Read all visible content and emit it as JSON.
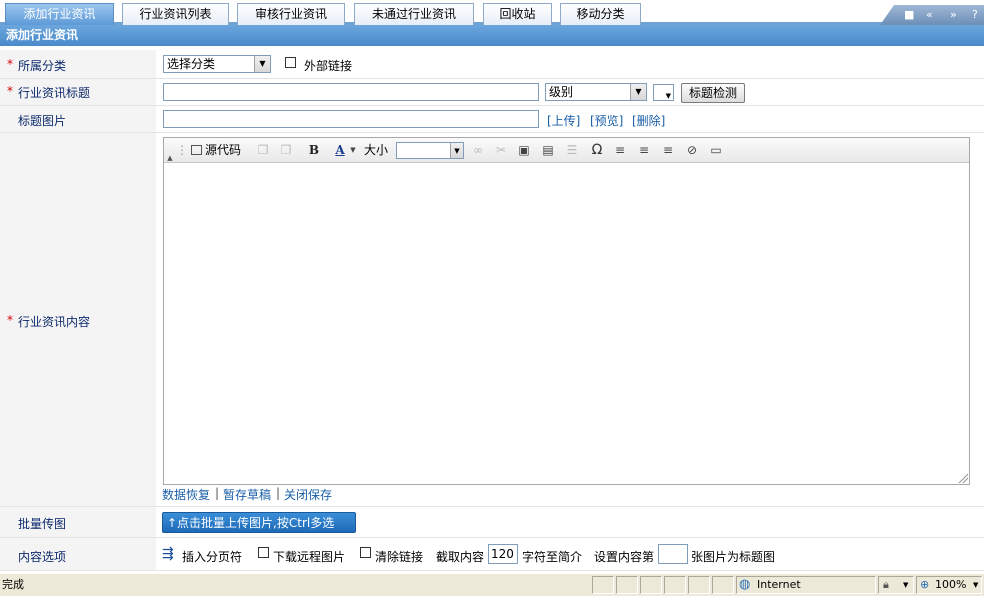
{
  "tabs": [
    {
      "label": "添加行业资讯"
    },
    {
      "label": "行业资讯列表"
    },
    {
      "label": "审核行业资讯"
    },
    {
      "label": "未通过行业资讯"
    },
    {
      "label": "回收站"
    },
    {
      "label": "移动分类"
    }
  ],
  "tab_controls": [
    "■",
    "«",
    "»",
    "?"
  ],
  "section_title": "添加行业资讯",
  "form": {
    "category": {
      "label": "所属分类",
      "required": "*",
      "select_value": "选择分类",
      "checkbox_label": "外部链接"
    },
    "title": {
      "label": "行业资讯标题",
      "required": "*",
      "level_value": "级别",
      "check_button": "标题检测"
    },
    "title_image": {
      "label": "标题图片",
      "upload": "[上传]",
      "preview": "[预览]",
      "delete": "[删除]"
    },
    "content": {
      "label": "行业资讯内容",
      "required": "*"
    },
    "batch": {
      "label": "批量传图",
      "button": "↑点击批量上传图片,按Ctrl多选"
    },
    "options": {
      "label": "内容选项",
      "page_break": "插入分页符",
      "download_remote": "下载远程图片",
      "clear_links": "清除链接",
      "intercept_prefix": "截取内容",
      "intercept_value": "120",
      "intercept_suffix": "字符至简介",
      "set_prefix": "设置内容第",
      "set_value": "",
      "set_suffix": "张图片为标题图"
    }
  },
  "editor": {
    "source_label": "源代码",
    "bold": "B",
    "font_color": "A",
    "size_label": "大小",
    "omega": "Ω"
  },
  "editor_links": {
    "restore": "数据恢复",
    "draft": "暂存草稿",
    "close_save": "关闭保存",
    "sep": "|"
  },
  "statusbar": {
    "left": "完成",
    "zone": "Internet",
    "zoom": "100%"
  }
}
